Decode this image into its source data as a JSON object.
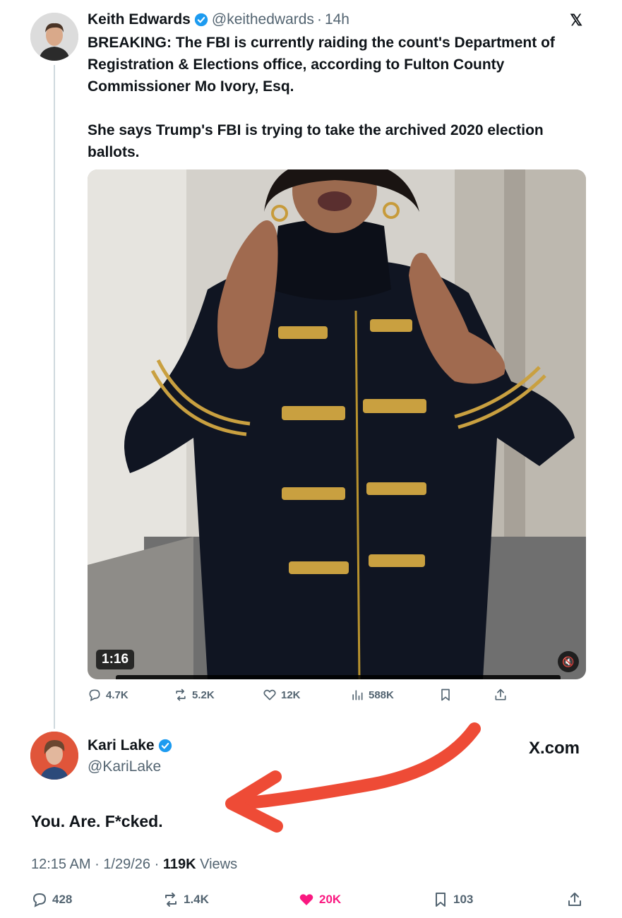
{
  "quoted_tweet": {
    "author_name": "Keith Edwards",
    "handle": "@keithedwards",
    "separator": "·",
    "time_ago": "14h",
    "platform_logo": "𝕏",
    "paragraphs": [
      "BREAKING: The FBI is currently raiding the count's Department of Registration & Elections office, according to Fulton County Commissioner Mo Ivory, Esq.",
      "She says Trump's FBI is trying to take the archived 2020 election ballots."
    ],
    "video": {
      "duration": "1:16",
      "mute_icon": "speaker-muted-icon"
    },
    "actions": {
      "replies": "4.7K",
      "reposts": "5.2K",
      "likes": "12K",
      "views": "588K"
    }
  },
  "main_tweet": {
    "author_name": "Kari Lake",
    "handle": "@KariLake",
    "site": "X.com",
    "text": "You. Are. F*cked.",
    "time": "12:15 AM",
    "date": "1/29/26",
    "views_count": "119K",
    "views_label": "Views",
    "dot": "·",
    "actions": {
      "replies": "428",
      "reposts": "1.4K",
      "likes": "20K",
      "bookmarks": "103"
    }
  },
  "colors": {
    "verified": "#1d9bf0",
    "secondary_text": "#536471",
    "like_active": "#f91880",
    "annotation_arrow": "#ee4b36"
  }
}
